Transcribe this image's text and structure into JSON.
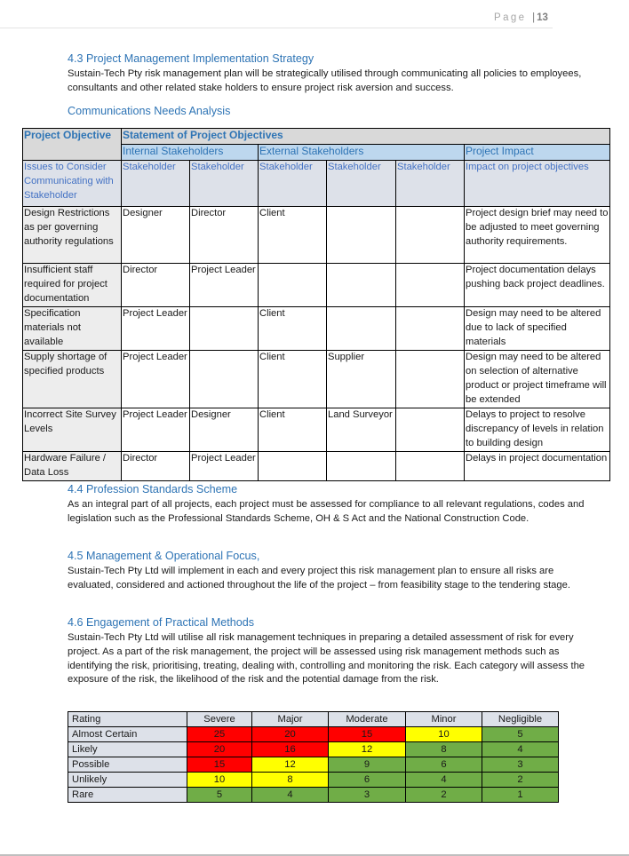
{
  "page_header": {
    "label": "Page",
    "separator": "|",
    "number": "13"
  },
  "section_4_3": {
    "heading": "4.3 Project Management Implementation Strategy",
    "body": "Sustain-Tech Pty risk management plan will be strategically utilised through communicating all policies to employees, consultants and other related stake holders to ensure project risk aversion and success."
  },
  "comm_needs": {
    "heading": "Communications Needs Analysis",
    "table": {
      "header_row1": {
        "project_objective": "Project Objective",
        "statement": "Statement of Project Objectives"
      },
      "header_row2": {
        "internal": "Internal Stakeholders",
        "external": "External Stakeholders",
        "impact": "Project Impact"
      },
      "header_row3": {
        "issues": "Issues to Consider Communicating with Stakeholder",
        "stakeholder_cols": [
          "Stakeholder",
          "Stakeholder",
          "Stakeholder",
          "Stakeholder",
          "Stakeholder"
        ],
        "impact": "Impact on project objectives"
      },
      "rows": [
        {
          "issue": "Design Restrictions as per governing authority regulations",
          "s1": "Designer",
          "s2": "Director",
          "s3": "Client",
          "s4": "",
          "s5": "",
          "impact": "Project design brief may need to be adjusted to meet governing authority requirements."
        },
        {
          "issue": "Insufficient staff required for project documentation",
          "s1": "Director",
          "s2": "Project Leader",
          "s3": "",
          "s4": "",
          "s5": "",
          "impact": "Project documentation delays pushing back project deadlines."
        },
        {
          "issue": "Specification materials not available",
          "s1": "Project Leader",
          "s2": "",
          "s3": "Client",
          "s4": "",
          "s5": "",
          "impact": "Design may need to be altered due to lack of specified materials"
        },
        {
          "issue": "Supply shortage of specified products",
          "s1": "Project Leader",
          "s2": "",
          "s3": "Client",
          "s4": "Supplier",
          "s5": "",
          "impact": "Design may need to be altered on selection of alternative product or project timeframe will be extended"
        },
        {
          "issue": "Incorrect Site Survey Levels",
          "s1": "Project Leader",
          "s2": "Designer",
          "s3": "Client",
          "s4": "Land Surveyor",
          "s5": "",
          "impact": "Delays to project to resolve discrepancy of levels in relation to building design"
        },
        {
          "issue": "Hardware Failure / Data Loss",
          "s1": "Director",
          "s2": "Project Leader",
          "s3": "",
          "s4": "",
          "s5": "",
          "impact": "Delays in project documentation"
        }
      ]
    }
  },
  "section_4_4": {
    "heading": "4.4 Profession Standards Scheme",
    "body": "As an integral part of all projects, each project must be assessed for compliance to all relevant regulations, codes and legislation such as the Professional Standards Scheme, OH & S Act and the National Construction Code."
  },
  "section_4_5": {
    "heading": "4.5 Management & Operational Focus,",
    "body": "Sustain-Tech Pty Ltd will implement in each and every project this risk management plan to ensure all risks are evaluated, considered and actioned throughout the life of the project – from feasibility stage to the tendering stage."
  },
  "section_4_6": {
    "heading": "4.6 Engagement of Practical Methods",
    "body": "Sustain-Tech Pty Ltd will utilise all risk management techniques in preparing a detailed assessment of risk for every project. As a part of the risk management, the project will be assessed using risk management methods such as identifying the risk, prioritising, treating, dealing with, controlling and monitoring the risk. Each category will assess the exposure of the risk, the likelihood of the risk and the potential damage from the risk."
  },
  "risk_matrix": {
    "corner_label": "Rating",
    "columns": [
      "Severe",
      "Major",
      "Moderate",
      "Minor",
      "Negligible"
    ],
    "colors": {
      "high": "#ff0000",
      "medium": "#ffff00",
      "low": "#70ad47"
    },
    "rows": [
      {
        "label": "Almost Certain",
        "values": [
          "25",
          "20",
          "15",
          "10",
          "5"
        ],
        "levels": [
          "high",
          "high",
          "high",
          "medium",
          "low"
        ]
      },
      {
        "label": "Likely",
        "values": [
          "20",
          "16",
          "12",
          "8",
          "4"
        ],
        "levels": [
          "high",
          "high",
          "medium",
          "low",
          "low"
        ]
      },
      {
        "label": "Possible",
        "values": [
          "15",
          "12",
          "9",
          "6",
          "3"
        ],
        "levels": [
          "high",
          "medium",
          "low",
          "low",
          "low"
        ]
      },
      {
        "label": "Unlikely",
        "values": [
          "10",
          "8",
          "6",
          "4",
          "2"
        ],
        "levels": [
          "medium",
          "medium",
          "low",
          "low",
          "low"
        ]
      },
      {
        "label": "Rare",
        "values": [
          "5",
          "4",
          "3",
          "2",
          "1"
        ],
        "levels": [
          "low",
          "low",
          "low",
          "low",
          "low"
        ]
      }
    ]
  }
}
